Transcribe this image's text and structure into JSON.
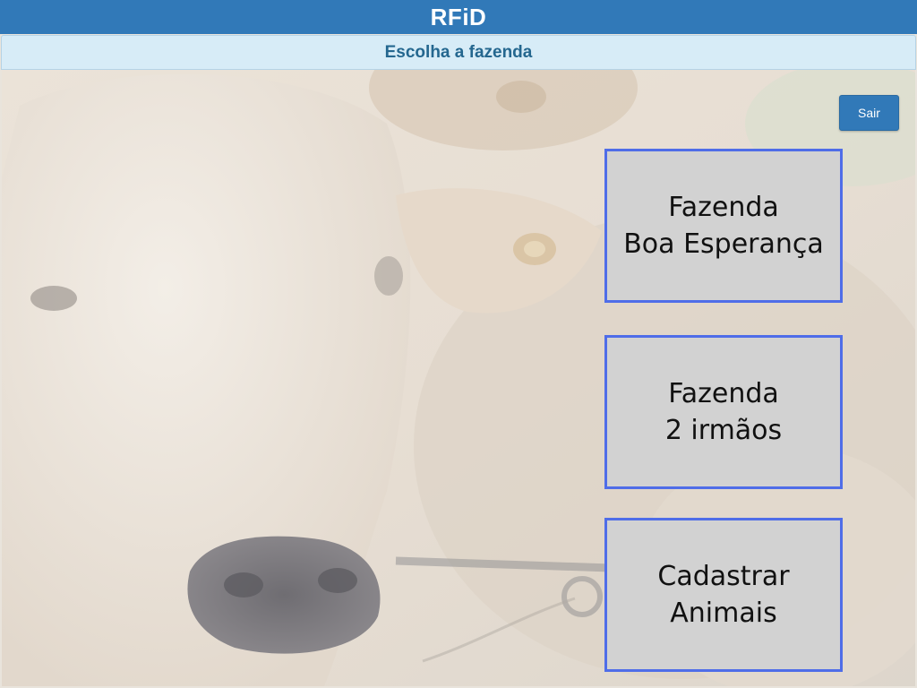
{
  "app": {
    "title": "RFiD"
  },
  "header": {
    "subtitle": "Escolha a fazenda"
  },
  "actions": {
    "logout_label": "Sair"
  },
  "menu": {
    "items": [
      {
        "line1": "Fazenda",
        "line2": "Boa Esperança"
      },
      {
        "line1": "Fazenda",
        "line2": "2 irmãos"
      },
      {
        "line1": "Cadastrar",
        "line2": "Animais"
      }
    ]
  },
  "colors": {
    "titlebar": "#3179b8",
    "subbar": "#d7ecf7",
    "button_border": "#4f6de8",
    "button_fill": "#d2d2d2"
  },
  "background": {
    "subject": "faded photo of a white cattle head"
  }
}
